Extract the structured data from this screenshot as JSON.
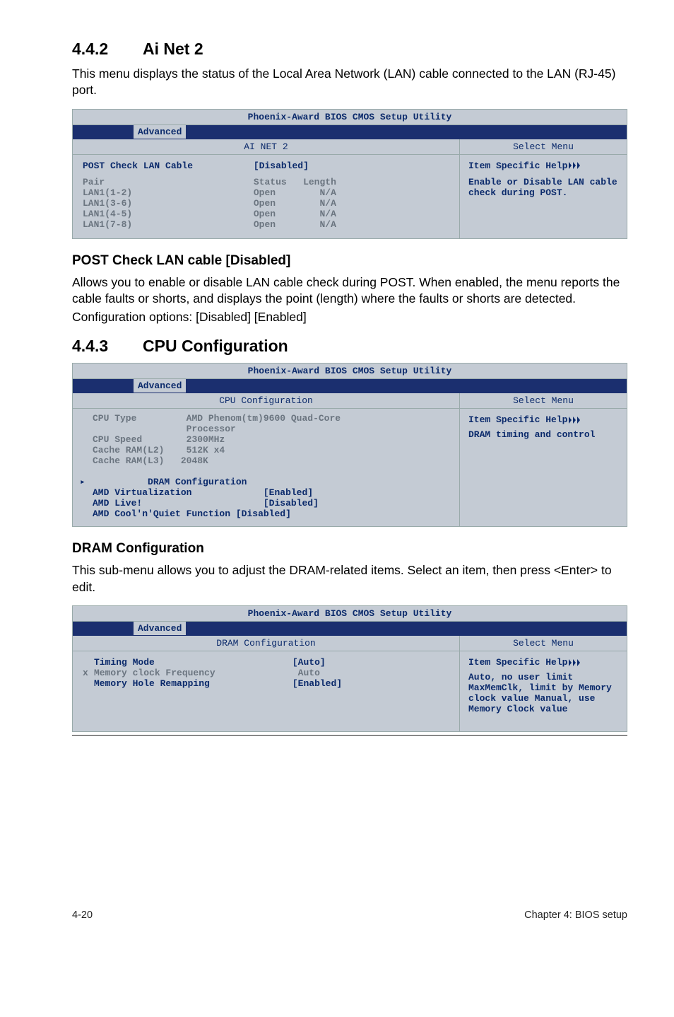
{
  "sec_442": {
    "num": "4.4.2",
    "title": "Ai Net 2"
  },
  "intro_442": "This menu displays the status of the Local Area Network (LAN) cable connected to the LAN (RJ-45) port.",
  "bios_title": "Phoenix-Award BIOS CMOS Setup Utility",
  "tab_advanced": "Advanced",
  "select_menu": "Select Menu",
  "ainet": {
    "subtitle": "AI NET 2",
    "opt_label": "POST Check LAN Cable",
    "opt_value": "[Disabled]",
    "col_pair": "Pair",
    "col_status": "Status",
    "col_length": "Length",
    "r1p": "LAN1(1-2)",
    "r1s": "Open",
    "r1l": "N/A",
    "r2p": "LAN1(3-6)",
    "r2s": "Open",
    "r2l": "N/A",
    "r3p": "LAN1(4-5)",
    "r3s": "Open",
    "r3l": "N/A",
    "r4p": "LAN1(7-8)",
    "r4s": "Open",
    "r4l": "N/A",
    "help_title": "Item Specific Help",
    "help_body": "Enable or Disable LAN cable check during POST."
  },
  "h3_post": "POST Check LAN cable [Disabled]",
  "p_post1": "Allows you to enable or disable LAN cable check during POST. When enabled, the menu reports the cable faults or shorts, and displays the point (length) where the faults or shorts are detected.",
  "p_post2": "Configuration options: [Disabled] [Enabled]",
  "sec_443": {
    "num": "4.4.3",
    "title": "CPU Configuration"
  },
  "cpu": {
    "subtitle": "CPU Configuration",
    "l1l": "CPU Type",
    "l1v": "AMD Phenom(tm)9600 Quad-Core",
    "l1b": "Processor",
    "l2l": "CPU Speed",
    "l2v": "2300MHz",
    "l3l": "Cache RAM(L2)",
    "l3v": " 512K x4",
    "l4l": "Cache RAM(L3)",
    "l4v": "2048K",
    "l5": "DRAM Configuration",
    "l6l": "AMD Virtualization",
    "l6v": "[Enabled]",
    "l7l": "AMD Live!",
    "l7v": "[Disabled]",
    "l8l": "AMD Cool'n'Quiet Function",
    "l8v": "[Disabled]",
    "help_title": "Item Specific Help",
    "help_body": "DRAM timing and control"
  },
  "h3_dram": "DRAM Configuration",
  "p_dram": "This sub-menu allows you to adjust the DRAM-related items. Select an item, then press <Enter> to edit.",
  "dram": {
    "subtitle": "DRAM Configuration",
    "l1l": "Timing Mode",
    "l1v": "[Auto]",
    "l2l": "Memory clock Frequency",
    "l2v": "Auto",
    "l3l": "Memory Hole Remapping",
    "l3v": "[Enabled]",
    "help_title": "Item Specific Help",
    "help_body": "Auto, no user limit MaxMemClk, limit by Memory clock value Manual, use Memory Clock value"
  },
  "footer_left": "4-20",
  "footer_right": "Chapter 4: BIOS setup"
}
